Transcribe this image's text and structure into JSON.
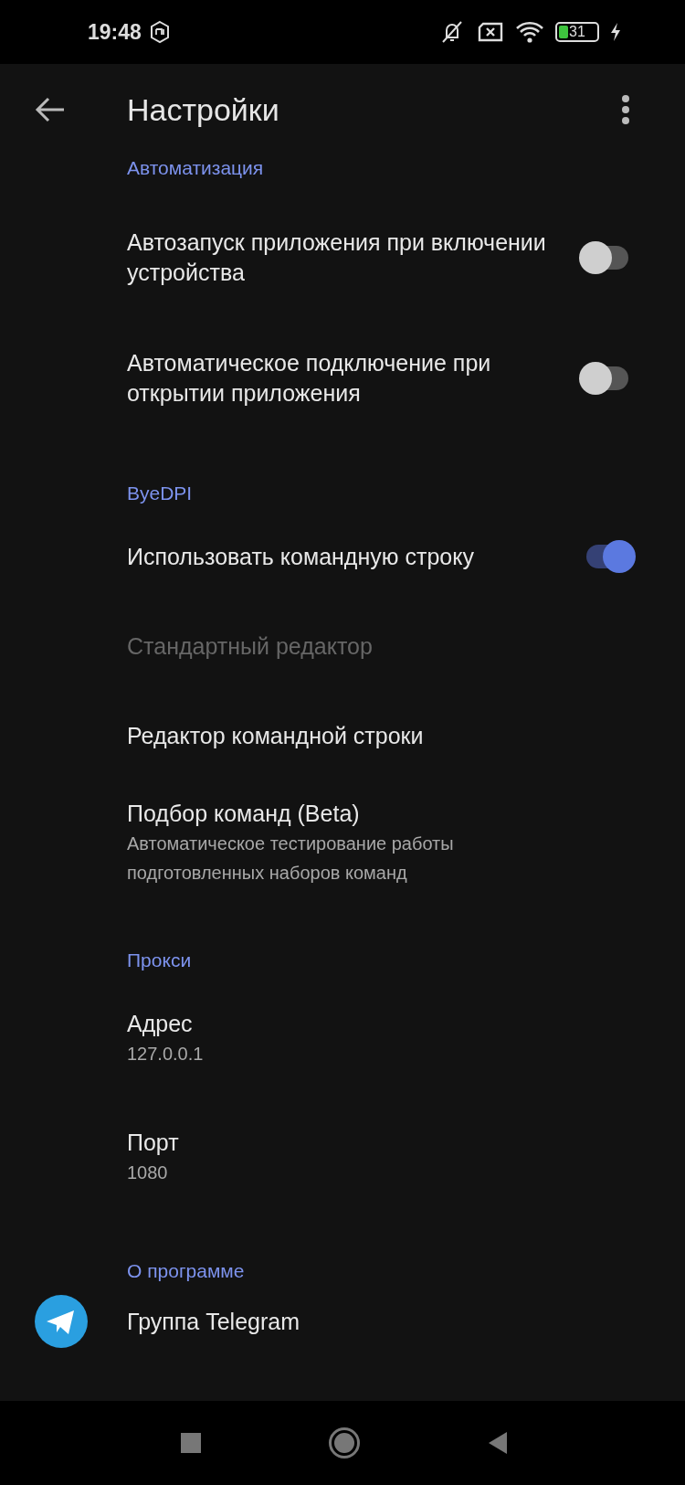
{
  "status_bar": {
    "time": "19:48",
    "battery": "31"
  },
  "app_bar": {
    "title": "Настройки"
  },
  "sections": [
    {
      "header": "Автоматизация",
      "items": [
        {
          "kind": "switch",
          "title": "Автозапуск приложения при включении устройства",
          "on": false,
          "disabled": false
        },
        {
          "kind": "switch",
          "title": "Автоматическое подключение при открытии приложения",
          "on": false,
          "disabled": false
        }
      ]
    },
    {
      "header": "ByeDPI",
      "items": [
        {
          "kind": "switch",
          "title": "Использовать командную строку",
          "on": true,
          "disabled": false
        },
        {
          "kind": "plain",
          "title": "Стандартный редактор",
          "disabled": true
        },
        {
          "kind": "plain",
          "title": "Редактор командной строки",
          "disabled": false
        },
        {
          "kind": "plain",
          "title": "Подбор команд (Beta)",
          "subtitle": "Автоматическое тестирование работы подготовленных наборов команд",
          "disabled": false
        }
      ]
    },
    {
      "header": "Прокси",
      "items": [
        {
          "kind": "plain",
          "title": "Адрес",
          "subtitle": "127.0.0.1",
          "disabled": false
        },
        {
          "kind": "plain",
          "title": "Порт",
          "subtitle": "1080",
          "disabled": false
        }
      ]
    },
    {
      "header": "О программе",
      "items": [
        {
          "kind": "link",
          "title": "Группа Telegram",
          "disabled": false
        }
      ]
    }
  ]
}
